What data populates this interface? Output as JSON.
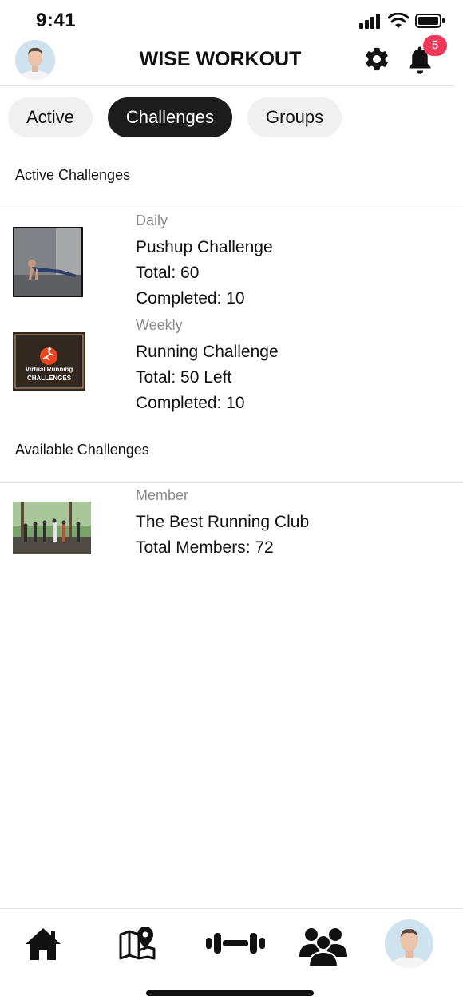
{
  "status": {
    "time": "9:41",
    "icons": [
      "signal-icon",
      "wifi-icon",
      "battery-icon"
    ]
  },
  "header": {
    "title": "WISE WORKOUT",
    "notification_count": "5",
    "icons": [
      "gear-icon",
      "bell-icon"
    ]
  },
  "tabs": [
    {
      "label": "Active",
      "active": false
    },
    {
      "label": "Challenges",
      "active": true
    },
    {
      "label": "Groups",
      "active": false
    }
  ],
  "active_section": {
    "title": "Active Challenges",
    "items": [
      {
        "kind": "Daily",
        "name": "Pushup Challenge",
        "total": "Total: 60",
        "completed": "Completed: 10"
      },
      {
        "kind": "Weekly",
        "name": "Running Challenge",
        "total": "Total: 50 Left",
        "completed": "Completed: 10",
        "thumb_text_1": "Virtual Running",
        "thumb_text_2": "CHALLENGES"
      }
    ]
  },
  "available_section": {
    "title": "Available Challenges",
    "items": [
      {
        "kind": "Member",
        "name": "The Best Running Club",
        "members": "Total Members: 72"
      }
    ]
  },
  "bottom_nav": {
    "icons": [
      "home-icon",
      "map-pin-icon",
      "dumbbell-icon",
      "group-icon",
      "profile-avatar"
    ]
  },
  "colors": {
    "accent_dark": "#1c1c1c",
    "badge": "#f0385a",
    "muted_text": "#8a8a8a",
    "running_orange": "#e8461e"
  }
}
